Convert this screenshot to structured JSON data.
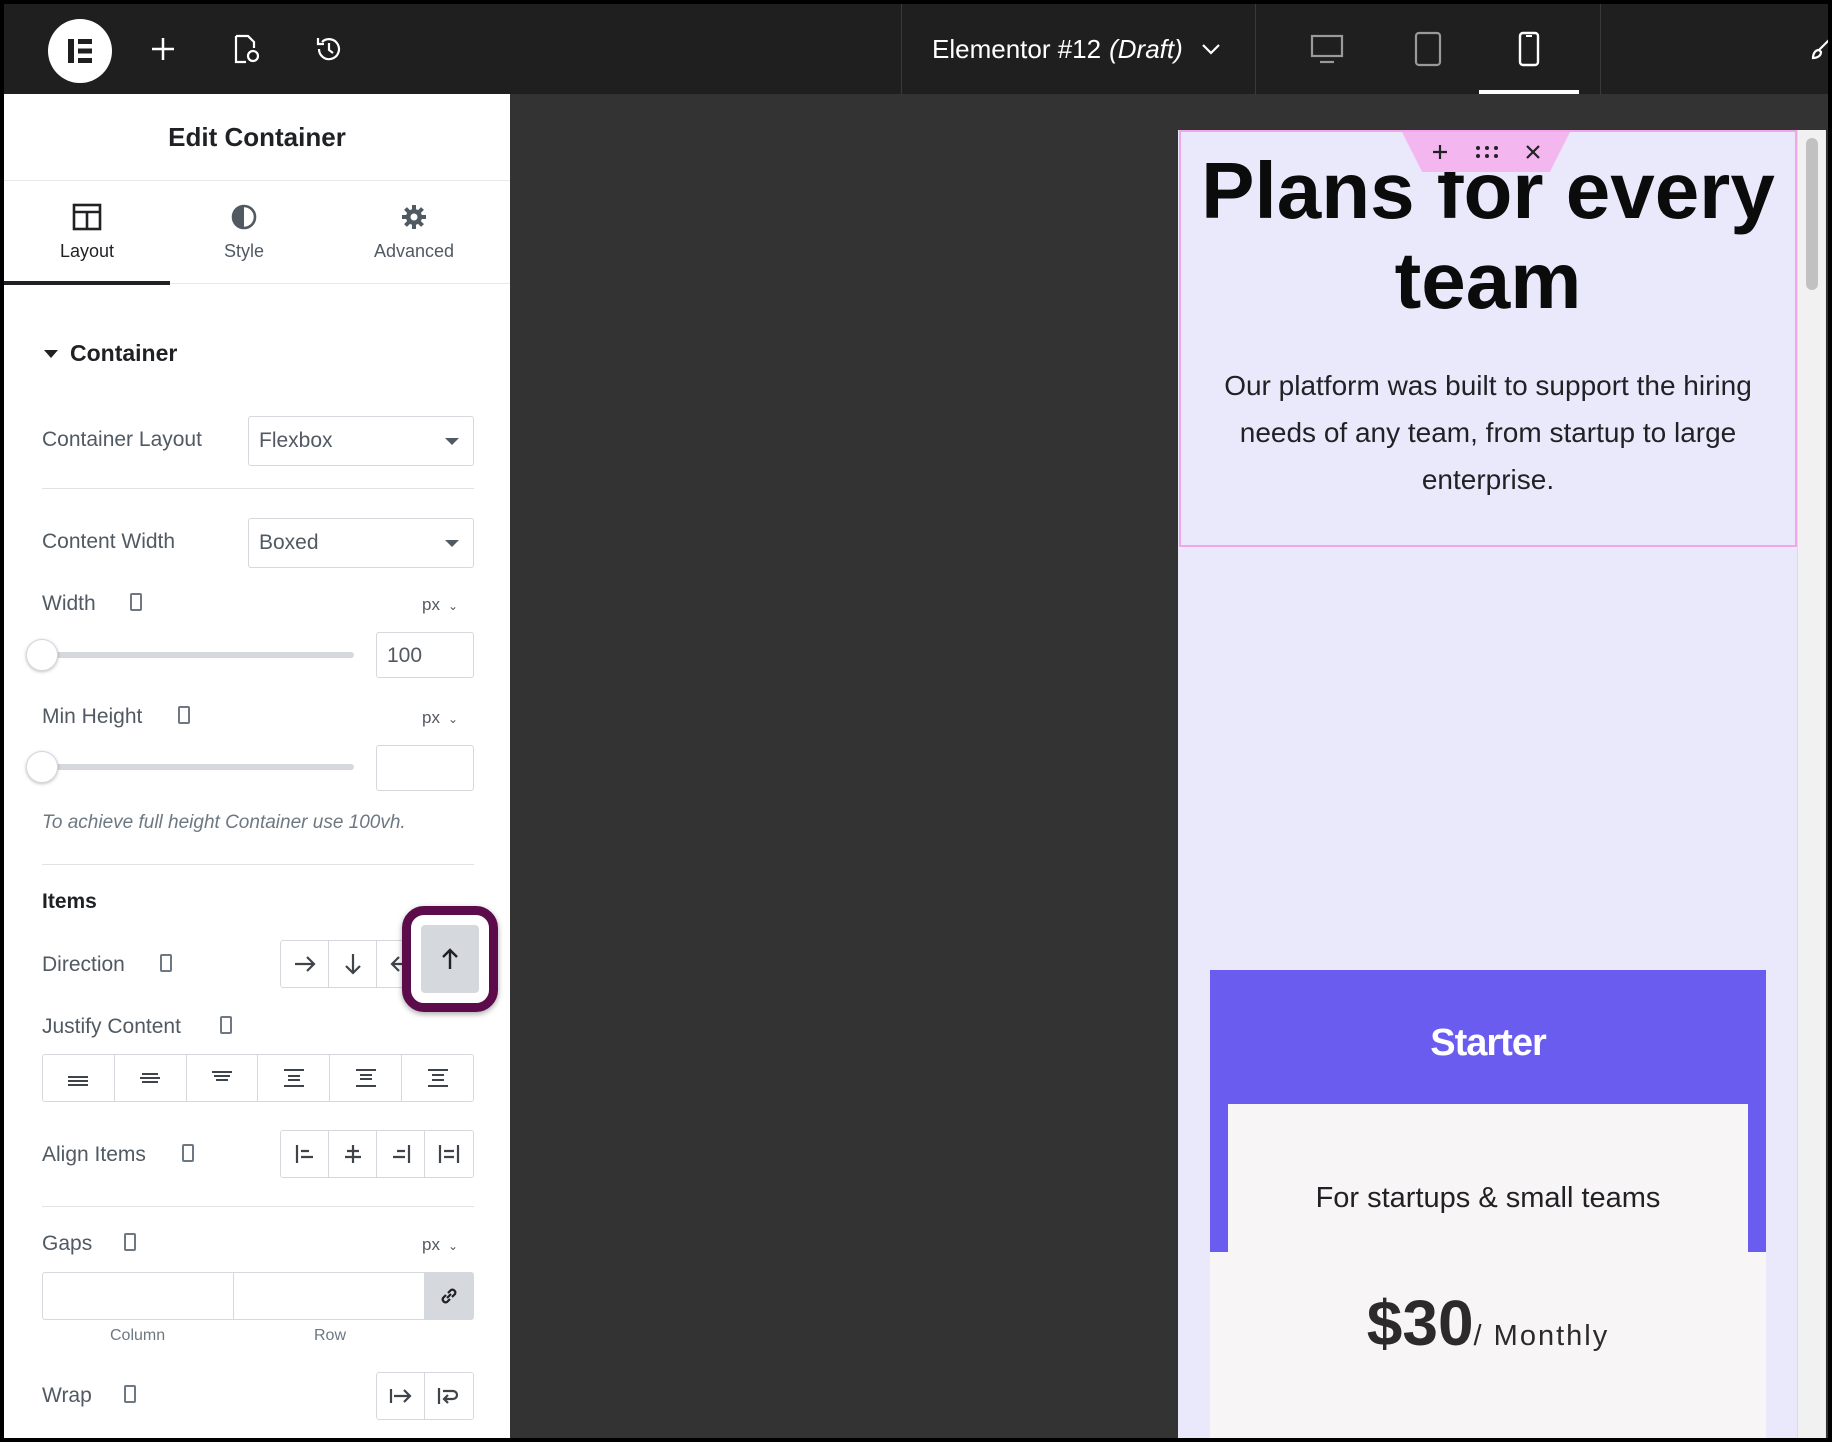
{
  "topbar": {
    "doc_name": "Elementor #12",
    "doc_status": "(Draft)"
  },
  "panel": {
    "title": "Edit Container",
    "tabs": [
      {
        "label": "Layout",
        "icon": "layout-columns-icon"
      },
      {
        "label": "Style",
        "icon": "half-circle-icon"
      },
      {
        "label": "Advanced",
        "icon": "gear-icon"
      }
    ],
    "section_title": "Container",
    "container_layout": {
      "label": "Container Layout",
      "value": "Flexbox"
    },
    "content_width": {
      "label": "Content Width",
      "value": "Boxed"
    },
    "width": {
      "label": "Width",
      "unit": "px",
      "value": "100"
    },
    "min_height": {
      "label": "Min Height",
      "unit": "px",
      "value": ""
    },
    "hint": "To achieve full height Container use 100vh.",
    "items_title": "Items",
    "direction_label": "Direction",
    "justify_label": "Justify Content",
    "align_label": "Align Items",
    "gaps": {
      "label": "Gaps",
      "unit": "px",
      "column": "Column",
      "row": "Row"
    },
    "wrap_label": "Wrap"
  },
  "canvas": {
    "hero_title": "Plans for every team",
    "hero_subtitle": "Our platform was built to support the hiring needs of any team, from startup to large enterprise.",
    "card_title": "Starter",
    "card_tagline": "For startups & small teams",
    "price_amount": "$30",
    "price_period": "/ Monthly"
  },
  "colors": {
    "topbar": "#1f1f1f",
    "highlight": "#5c0c4a",
    "card_accent": "#6b5cf0",
    "page_bg": "#e9e9fb",
    "selection_outline": "#f2a6ea"
  }
}
